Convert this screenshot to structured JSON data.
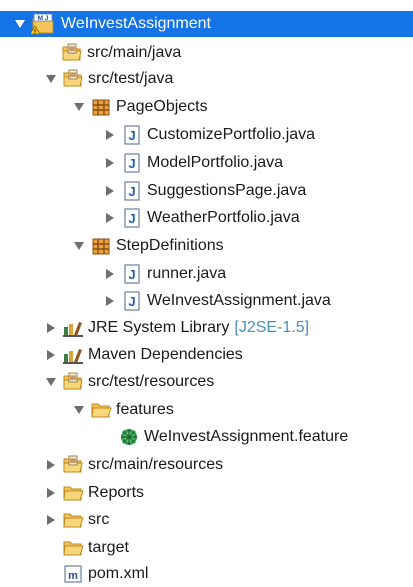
{
  "tree": {
    "project": {
      "label": "WeInvestAssignment"
    },
    "src_main_java": {
      "label": "src/main/java"
    },
    "src_test_java": {
      "label": "src/test/java"
    },
    "page_objects": {
      "label": "PageObjects"
    },
    "customize_portfolio": {
      "label": "CustomizePortfolio.java"
    },
    "model_portfolio": {
      "label": "ModelPortfolio.java"
    },
    "suggestions_page": {
      "label": "SuggestionsPage.java"
    },
    "weather_portfolio": {
      "label": "WeatherPortfolio.java"
    },
    "step_definitions": {
      "label": "StepDefinitions"
    },
    "runner": {
      "label": "runner.java"
    },
    "weinvest_java": {
      "label": "WeInvestAssignment.java"
    },
    "jre_library": {
      "label": "JRE System Library",
      "decoration": "[J2SE-1.5]"
    },
    "maven_deps": {
      "label": "Maven Dependencies"
    },
    "src_test_resources": {
      "label": "src/test/resources"
    },
    "features": {
      "label": "features"
    },
    "feature_file": {
      "label": "WeInvestAssignment.feature"
    },
    "src_main_resources": {
      "label": "src/main/resources"
    },
    "reports": {
      "label": "Reports"
    },
    "src": {
      "label": "src"
    },
    "target": {
      "label": "target"
    },
    "pom": {
      "label": "pom.xml"
    }
  }
}
